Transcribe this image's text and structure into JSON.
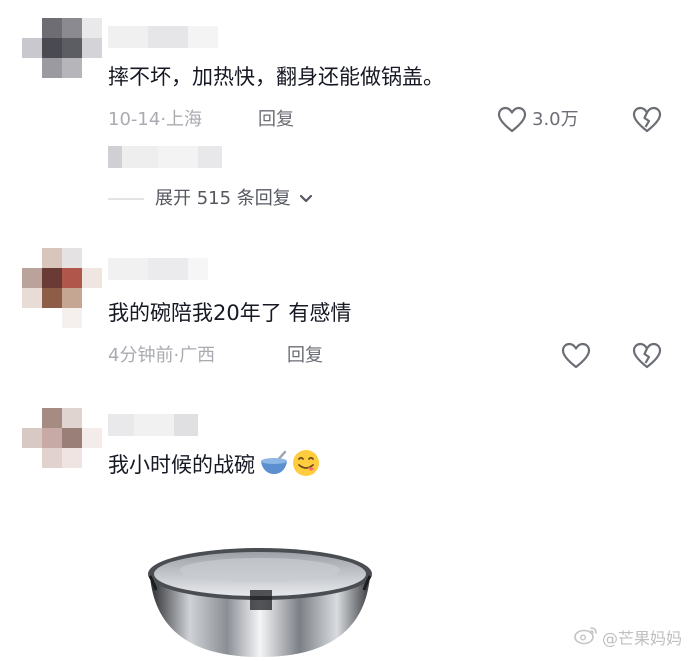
{
  "comments": [
    {
      "text": "摔不坏，加热快，翻身还能做锅盖。",
      "date": "10-14",
      "location": "上海",
      "reply_label": "回复",
      "like_count": "3.0万"
    },
    {
      "text": "我的碗陪我20年了 有感情",
      "date": "4分钟前",
      "location": "广西",
      "reply_label": "回复"
    },
    {
      "text": "我小时候的战碗",
      "emoji": [
        "bowl-with-spoon",
        "face-savoring-food"
      ]
    }
  ],
  "expand": {
    "label": "展开 515 条回复",
    "icon": "chevron-down-icon"
  },
  "watermark": {
    "label": "@芒果妈妈"
  },
  "colors": {
    "text": "#161823",
    "meta": "#a9abb0",
    "action": "#6c6e75"
  }
}
